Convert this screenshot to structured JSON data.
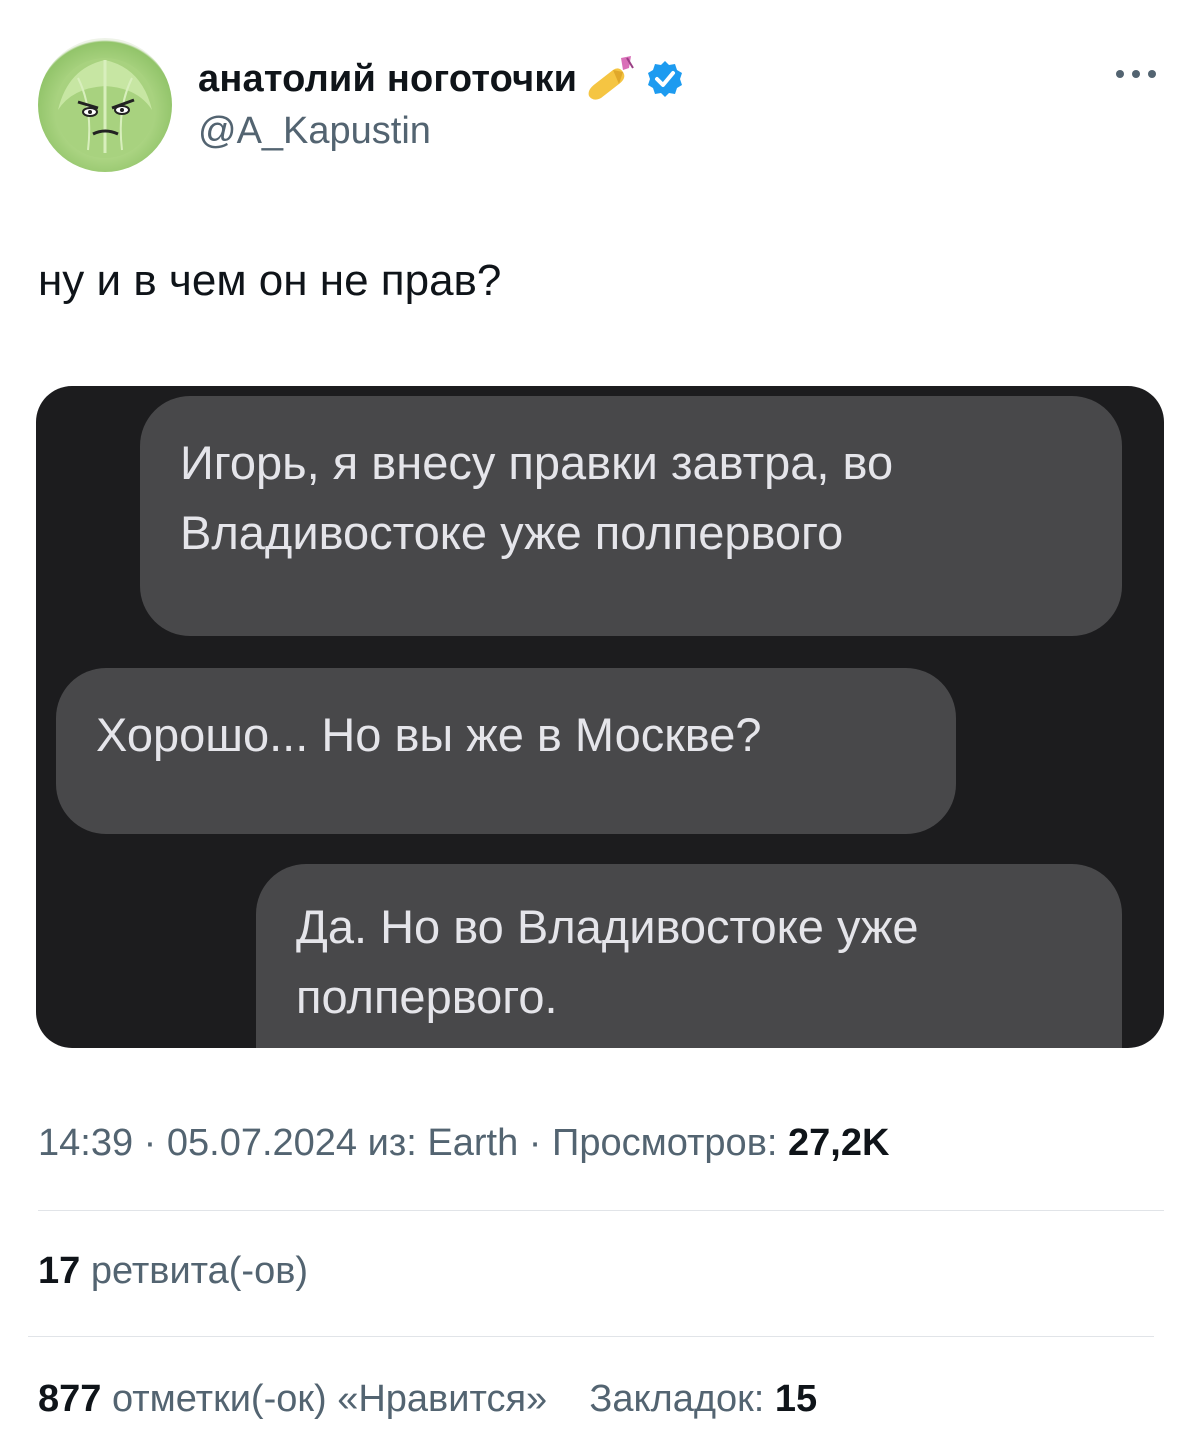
{
  "author": {
    "display_name": "анатолий ноготочки",
    "handle": "@A_Kapustin",
    "avatar_icon": "cabbage-face-avatar",
    "name_emoji_icon": "nail-polish-icon",
    "verified_icon": "verified-badge-icon",
    "verified_color": "#1d9bf0"
  },
  "more_icon": "more-dots-icon",
  "tweet": {
    "text": "ну и в чем он не прав?"
  },
  "chat_image": {
    "background": "#1c1c1e",
    "bubble_color": "#48484a",
    "messages": [
      {
        "line1": "Игорь, я внесу правки завтра, во",
        "line2": "Владивостоке уже полпервого"
      },
      {
        "line1": "Хорошо... Но вы же в Москве?"
      },
      {
        "line1": "Да. Но во Владивостоке уже",
        "line2": "полпервого."
      }
    ]
  },
  "meta": {
    "time": "14:39",
    "date": "05.07.2024",
    "source_prefix": "из:",
    "source": "Earth",
    "views_label": "Просмотров:",
    "views_count": "27,2K"
  },
  "stats": {
    "retweets_count": "17",
    "retweets_label": "ретвита(-ов)",
    "likes_count": "877",
    "likes_label": "отметки(-ок) «Нравится»",
    "bookmarks_label": "Закладок:",
    "bookmarks_count": "15"
  }
}
